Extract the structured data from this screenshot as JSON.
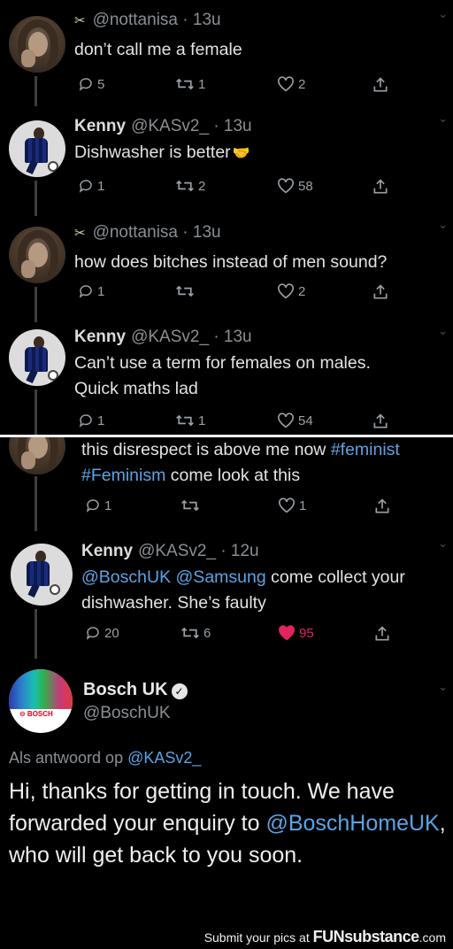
{
  "tweets": [
    {
      "badge": "✂",
      "name": "",
      "handle": "@nottanisa",
      "time": "· 13u",
      "text": "don’t call me a female",
      "reply": "5",
      "retweet": "1",
      "like": "2"
    },
    {
      "name": "Kenny",
      "handle": "@KASv2_",
      "time": "· 13u",
      "text": "Dishwasher is better",
      "emoji": "🤝",
      "reply": "1",
      "retweet": "2",
      "like": "58"
    },
    {
      "badge": "✂",
      "name": "",
      "handle": "@nottanisa",
      "time": "· 13u",
      "text": "how does bitches instead of men sound?",
      "reply": "1",
      "retweet": "",
      "like": "2"
    },
    {
      "name": "Kenny",
      "handle": "@KASv2_",
      "time": "· 13u",
      "text_line1": "Can’t use a term for females on males.",
      "text_line2": "Quick maths lad",
      "reply": "1",
      "retweet": "1",
      "like": "54"
    },
    {
      "text_plain1": "this disrespect is above me now ",
      "hashtag1": "#feminist",
      "hashtag2": "#Feminism",
      "text_plain2": "  come look at this",
      "reply": "1",
      "retweet": "",
      "like": "1"
    },
    {
      "name": "Kenny",
      "handle": "@KASv2_",
      "time": "· 12u",
      "mention1": "@BoschUK",
      "mention2": "@Samsung",
      "text_plain1": " come collect your",
      "text_line2": "dishwasher. She’s faulty",
      "reply": "20",
      "retweet": "6",
      "like": "95"
    }
  ],
  "bosch": {
    "name": "Bosch UK",
    "verified": "✓",
    "handle": "@BoschUK",
    "logo": "⊖ BOSCH",
    "reply_prefix": "Als antwoord op ",
    "reply_handle": "@KASv2_",
    "text1": "Hi, thanks for getting in touch. We have forwarded your enquiry to ",
    "text_mention": "@BoschHomeUK",
    "text2": ", who will get back to you soon."
  },
  "footer": {
    "prefix": "Submit your pics at ",
    "brand": "FUNsubstance",
    "suffix": ".com"
  },
  "colors": {
    "background": "#000000",
    "mention": "#5aa4e6",
    "like_active": "#e0245e",
    "muted": "#8a8f94"
  },
  "icons": [
    "reply-icon",
    "retweet-icon",
    "heart-icon",
    "share-icon",
    "chevron-down-icon",
    "verified-icon"
  ]
}
